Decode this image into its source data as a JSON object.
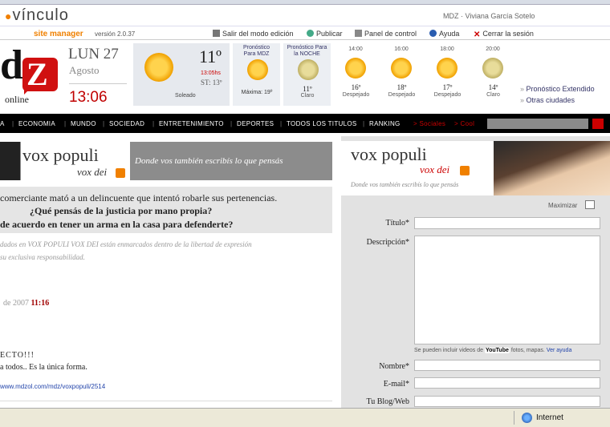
{
  "vinculo": {
    "logo": "vínculo",
    "subtitle": "site manager",
    "version": "versión 2.0.37",
    "user": "MDZ · Viviana García Sotelo"
  },
  "admin_links": [
    "Salir del modo edición",
    "Publicar",
    "Panel de control",
    "Ayuda",
    "Cerrar la sesión"
  ],
  "header": {
    "brand": "online",
    "date_day": "LUN 27",
    "date_month": "Agosto",
    "time": "13:06"
  },
  "weather": {
    "current": {
      "temp": "11º",
      "time": "13:05hs",
      "st": "ST: 13º",
      "desc": "Soleado"
    },
    "forecast_mdz": {
      "label": "Pronóstico Para MDZ",
      "value": "Máxima: 19º"
    },
    "forecast_night": {
      "label": "Pronóstico Para la NOCHE",
      "temp": "11º",
      "desc": "Claro"
    },
    "hours": [
      {
        "time": "14:00",
        "temp": "16º",
        "desc": "Despejado",
        "icon": "sun"
      },
      {
        "time": "16:00",
        "temp": "18º",
        "desc": "Despejado",
        "icon": "sun"
      },
      {
        "time": "18:00",
        "temp": "17º",
        "desc": "Despejado",
        "icon": "sun"
      },
      {
        "time": "20:00",
        "temp": "14º",
        "desc": "Claro",
        "icon": "moon"
      }
    ],
    "links": [
      "Pronóstico Extendido",
      "Otras ciudades"
    ]
  },
  "nav": {
    "items": [
      "A",
      "ECONOMIA",
      "MUNDO",
      "SOCIEDAD",
      "ENTRETENIMIENTO",
      "DEPORTES",
      "TODOS LOS TITULOS",
      "RANKING"
    ],
    "extra": [
      "Sociales",
      "Cool"
    ]
  },
  "left": {
    "vox_title": "vox populi",
    "vox_sub": "vox dei",
    "tagline": "Donde vos también escribís lo que pensás",
    "q1": "comerciante mató a un delincuente que intentó robarle sus pertenencias.",
    "q2": "¿Qué pensás de la justicia por mano propia?",
    "q3": "de acuerdo en tener un arma en la casa para defenderte?",
    "disclaimer1": "dados en VOX POPULI VOX DEI están enmarcados dentro de la libertad de expresión",
    "disclaimer2": "su exclusiva responsabilidad.",
    "post_date": "de 2007",
    "post_time": "11:16",
    "post_title": "ECTO!!!",
    "post_body": "a todos.. Es la única forma.",
    "post_link": "www.mdzol.com/mdz/voxpopuli/2514"
  },
  "right": {
    "vox_title": "vox populi",
    "vox_sub": "vox dei",
    "tagline": "Donde vos también escribís lo que pensás",
    "maximize": "Maximizar",
    "labels": {
      "titulo": "Título*",
      "descripcion": "Descripción*",
      "nombre": "Nombre*",
      "email": "E-mail*",
      "blog": "Tu Blog/Web"
    },
    "help_text": "Se pueden incluir videos de",
    "help_text2": "fotos, mapas.",
    "help_link": "Ver ayuda",
    "youtube": "YouTube"
  },
  "status": {
    "zone": "Internet"
  },
  "colors": {
    "accent_red": "#c00000",
    "orange": "#f08000",
    "nav_bg": "#000000"
  }
}
